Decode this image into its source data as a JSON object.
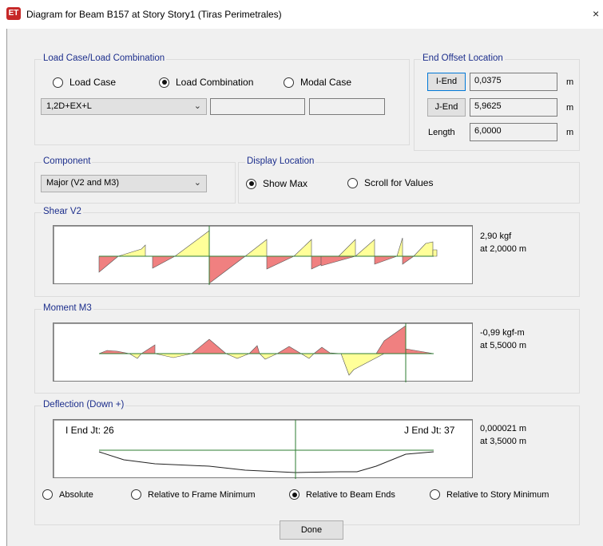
{
  "window": {
    "title": "Diagram for Beam B157 at Story Story1 (Tiras Perimetrales)",
    "app_icon_text": "ET",
    "close_glyph": "×"
  },
  "load_case": {
    "group_label": "Load Case/Load Combination",
    "options": [
      "Load Case",
      "Load Combination",
      "Modal Case"
    ],
    "selected": "Load Combination",
    "combo_value": "1,2D+EX+L"
  },
  "end_offset": {
    "group_label": "End Offset Location",
    "i_end_label": "I-End",
    "i_end_value": "0,0375",
    "j_end_label": "J-End",
    "j_end_value": "5,9625",
    "length_label": "Length",
    "length_value": "6,0000",
    "unit": "m"
  },
  "component": {
    "group_label": "Component",
    "value": "Major (V2 and M3)"
  },
  "display_location": {
    "group_label": "Display Location",
    "options": [
      "Show Max",
      "Scroll for Values"
    ],
    "selected": "Show Max"
  },
  "shear": {
    "label": "Shear V2",
    "value": "2,90 kgf",
    "at": "at 2,0000 m"
  },
  "moment": {
    "label": "Moment M3",
    "value": "-0,99 kgf-m",
    "at": "at 5,5000 m"
  },
  "deflection": {
    "label": "Deflection (Down +)",
    "i_end": "I End Jt: 26",
    "j_end": "J End Jt: 37",
    "value": "0,000021 m",
    "at": "at 3,5000 m",
    "options": [
      "Absolute",
      "Relative to Frame Minimum",
      "Relative to Beam Ends",
      "Relative to Story Minimum"
    ],
    "selected": "Relative to Beam Ends"
  },
  "done_label": "Done",
  "colors": {
    "positive_fill": "#ffff99",
    "negative_fill": "#f08080",
    "axis_line": "#2e7d32",
    "group_title": "#1c2e8c"
  }
}
